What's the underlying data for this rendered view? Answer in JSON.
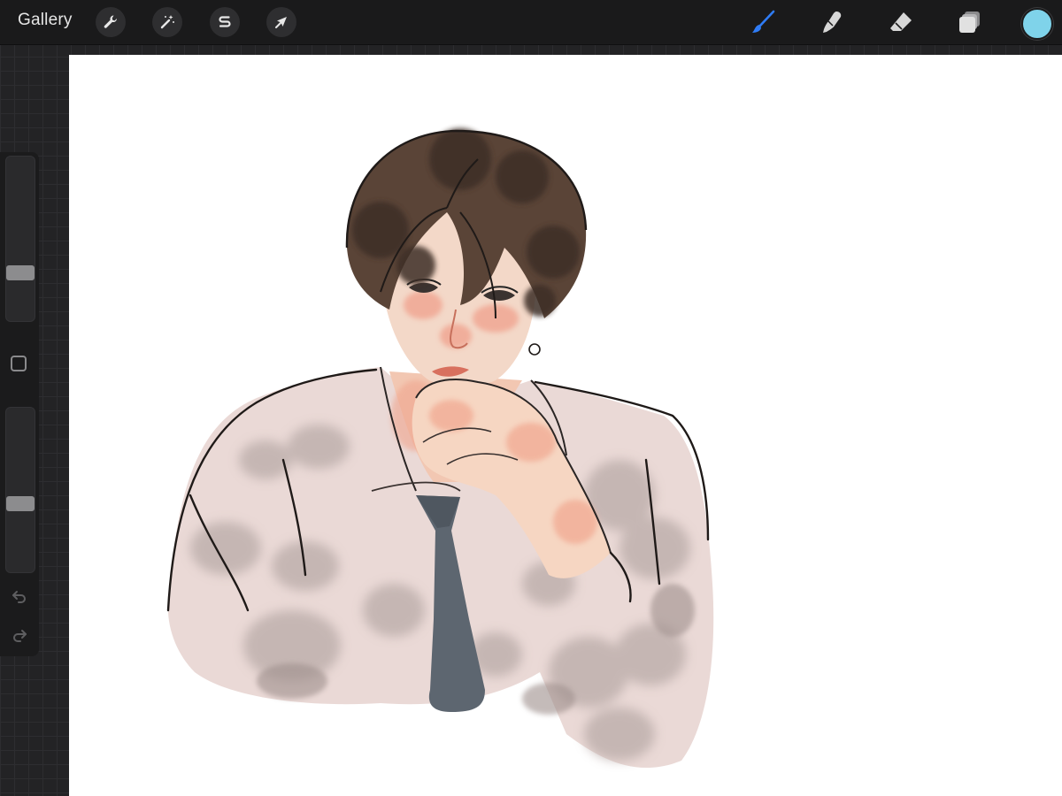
{
  "topbar": {
    "gallery_label": "Gallery",
    "left_tools": [
      {
        "name": "actions",
        "icon": "wrench-icon"
      },
      {
        "name": "adjustments",
        "icon": "magic-wand-icon"
      },
      {
        "name": "selection",
        "icon": "selection-s-icon"
      },
      {
        "name": "transform",
        "icon": "arrow-cursor-icon"
      }
    ],
    "right_tools": [
      {
        "name": "brush",
        "icon": "brush-icon",
        "active": true
      },
      {
        "name": "smudge",
        "icon": "smudge-finger-icon",
        "active": false
      },
      {
        "name": "eraser",
        "icon": "eraser-icon",
        "active": false
      },
      {
        "name": "layers",
        "icon": "layers-icon",
        "active": false
      }
    ],
    "current_color": "#7fd3ea"
  },
  "sidebar": {
    "brush_size_level": 0.27,
    "opacity_level": 0.41,
    "modify_icon": "square-icon",
    "undo_icon": "undo-arrow-icon",
    "redo_icon": "redo-arrow-icon"
  },
  "colors": {
    "active_tool": "#2f7cf6",
    "inactive_tool": "#d7d7d7",
    "shirt": "#ead9d6",
    "shirt_shadow": "#b9aba8",
    "hair": "#5a4437",
    "hair_dark": "#3e2f28",
    "skin": "#f3d2c0",
    "blush": "#f0a08c",
    "tie": "#5d6670"
  }
}
